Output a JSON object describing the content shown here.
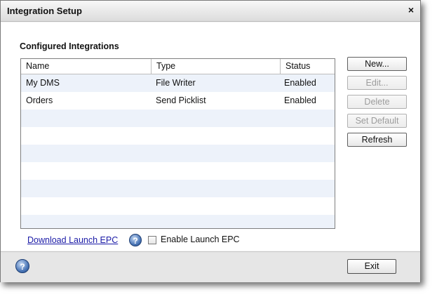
{
  "dialog": {
    "title": "Integration Setup",
    "close_label": "×"
  },
  "section_title": "Configured Integrations",
  "table": {
    "columns": [
      "Name",
      "Type",
      "Status"
    ],
    "rows": [
      {
        "name": "My DMS",
        "type": "File Writer",
        "status": "Enabled"
      },
      {
        "name": "Orders",
        "type": "Send Picklist",
        "status": "Enabled"
      }
    ]
  },
  "buttons": {
    "new": "New...",
    "edit": "Edit...",
    "delete": "Delete",
    "set_default": "Set Default",
    "refresh": "Refresh"
  },
  "download_link": "Download Launch EPC",
  "help_glyph": "?",
  "enable_launch_epc": {
    "label": "Enable Launch EPC",
    "checked": false
  },
  "footer": {
    "exit": "Exit"
  },
  "icons": [
    "close-icon",
    "help-icon"
  ],
  "colors": {
    "link": "#1a1aa6",
    "row_alt": "#edf2fa",
    "help_icon": "#4d78b8"
  }
}
